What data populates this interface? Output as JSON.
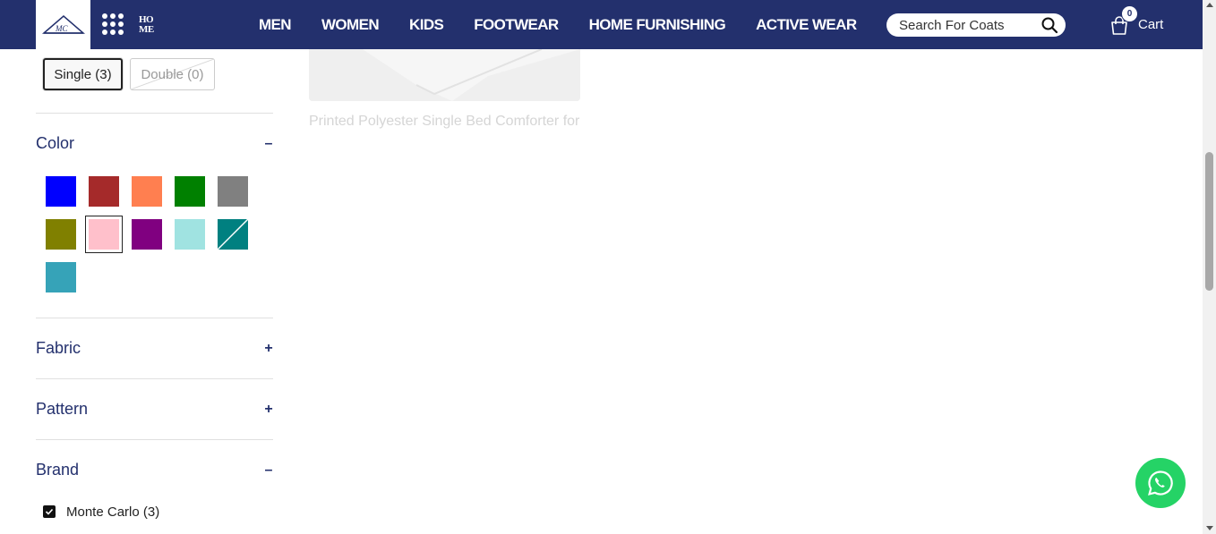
{
  "header": {
    "brand_mark": "MC",
    "home_logo_top": "HO",
    "home_logo_bottom": "ME",
    "nav": [
      "MEN",
      "WOMEN",
      "KIDS",
      "FOOTWEAR",
      "HOME FURNISHING",
      "ACTIVE WEAR"
    ],
    "search_placeholder": "Search For Coats",
    "cart_count": "0",
    "cart_label": "Cart",
    "bg_color": "#23306d"
  },
  "filters": {
    "size_options": [
      {
        "label": "Single (3)",
        "selected": true
      },
      {
        "label": "Double (0)",
        "selected": false
      }
    ],
    "color": {
      "title": "Color",
      "toggle": "–",
      "swatches": [
        {
          "name": "blue",
          "hex": "#0000ff"
        },
        {
          "name": "brown",
          "hex": "#a52a2a"
        },
        {
          "name": "coral",
          "hex": "#ff7f50"
        },
        {
          "name": "green",
          "hex": "#008000"
        },
        {
          "name": "grey",
          "hex": "#808080"
        },
        {
          "name": "olive",
          "hex": "#808000"
        },
        {
          "name": "pink",
          "hex": "#ffc0cb",
          "selected": true
        },
        {
          "name": "purple",
          "hex": "#800080"
        },
        {
          "name": "aqua",
          "hex": "#a0e3e1"
        },
        {
          "name": "teal",
          "hex": "#008080",
          "disabled": true
        },
        {
          "name": "cyan-blue",
          "hex": "#36a3b8"
        }
      ]
    },
    "fabric": {
      "title": "Fabric",
      "toggle": "+"
    },
    "pattern": {
      "title": "Pattern",
      "toggle": "+"
    },
    "brand": {
      "title": "Brand",
      "toggle": "–",
      "options": [
        {
          "label": "Monte Carlo (3)",
          "checked": true
        }
      ]
    }
  },
  "product": {
    "title": "Printed Polyester Single Bed Comforter for"
  }
}
